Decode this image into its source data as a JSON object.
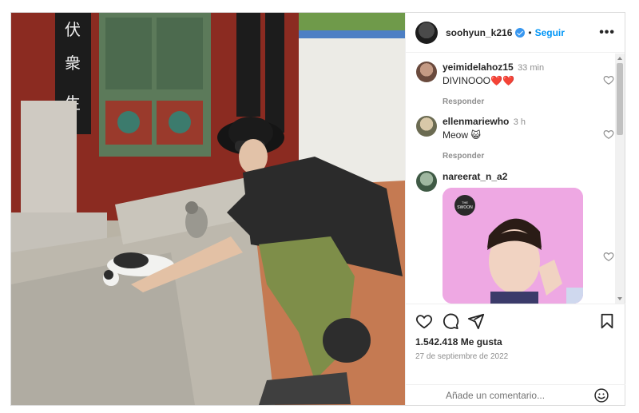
{
  "header": {
    "username": "soohyun_k216",
    "separator": "•",
    "follow_label": "Seguir",
    "more_label": "•••"
  },
  "comments": [
    {
      "user": "yeimidelahoz15",
      "time": "33 min",
      "text": "DIVINOOO❤️❤️",
      "reply": "Responder"
    },
    {
      "user": "ellenmariewho",
      "time": "3 h",
      "text": "Meow 😺",
      "reply": "Responder"
    },
    {
      "user": "nareerat_n_a2",
      "time": "",
      "text": "",
      "reply": ""
    }
  ],
  "story_card": {
    "logo_text": "THE SWOON"
  },
  "actions": {
    "likes": "1.542.418 Me gusta",
    "date": "27 de septiembre de 2022"
  },
  "add_comment": {
    "placeholder": "Añade un comentario..."
  },
  "colors": {
    "link_blue": "#0095f6",
    "verified_blue": "#3897f0",
    "muted": "#8e8e8e"
  }
}
